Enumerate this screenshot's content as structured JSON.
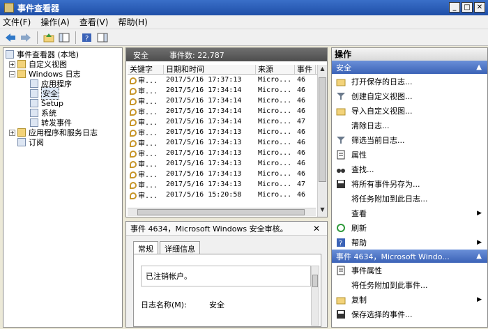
{
  "window": {
    "title": "事件查看器"
  },
  "menu": [
    "文件(F)",
    "操作(A)",
    "查看(V)",
    "帮助(H)"
  ],
  "tree": {
    "root": "事件查看器 (本地)",
    "custom_views": "自定义视图",
    "windows_logs": "Windows 日志",
    "logs": [
      "应用程序",
      "安全",
      "Setup",
      "系统",
      "转发事件"
    ],
    "apps_services": "应用程序和服务日志",
    "subscriptions": "订阅"
  },
  "log_header": {
    "name": "安全",
    "count_label": "事件数: 22,787"
  },
  "grid": {
    "columns": [
      "关键字",
      "日期和时间",
      "来源",
      "事件"
    ],
    "rows": [
      {
        "kw": "审...",
        "dt": "2017/5/16 17:37:13",
        "src": "Micro...",
        "id": "46"
      },
      {
        "kw": "审...",
        "dt": "2017/5/16 17:34:14",
        "src": "Micro...",
        "id": "46"
      },
      {
        "kw": "审...",
        "dt": "2017/5/16 17:34:14",
        "src": "Micro...",
        "id": "46"
      },
      {
        "kw": "审...",
        "dt": "2017/5/16 17:34:14",
        "src": "Micro...",
        "id": "46"
      },
      {
        "kw": "审...",
        "dt": "2017/5/16 17:34:14",
        "src": "Micro...",
        "id": "47"
      },
      {
        "kw": "审...",
        "dt": "2017/5/16 17:34:13",
        "src": "Micro...",
        "id": "46"
      },
      {
        "kw": "审...",
        "dt": "2017/5/16 17:34:13",
        "src": "Micro...",
        "id": "46"
      },
      {
        "kw": "审...",
        "dt": "2017/5/16 17:34:13",
        "src": "Micro...",
        "id": "46"
      },
      {
        "kw": "审...",
        "dt": "2017/5/16 17:34:13",
        "src": "Micro...",
        "id": "46"
      },
      {
        "kw": "审...",
        "dt": "2017/5/16 17:34:13",
        "src": "Micro...",
        "id": "46"
      },
      {
        "kw": "审...",
        "dt": "2017/5/16 17:34:13",
        "src": "Micro...",
        "id": "47"
      },
      {
        "kw": "审...",
        "dt": "2017/5/16 15:20:58",
        "src": "Micro...",
        "id": "46"
      }
    ]
  },
  "detail": {
    "title": "事件 4634，Microsoft Windows 安全审核。",
    "tabs": [
      "常规",
      "详细信息"
    ],
    "message": "已注销帐户。",
    "log_name_label": "日志名称(M):",
    "log_name_value": "安全"
  },
  "actions": {
    "title": "操作",
    "section1": "安全",
    "items1": [
      "打开保存的日志...",
      "创建自定义视图...",
      "导入自定义视图...",
      "清除日志...",
      "筛选当前日志...",
      "属性",
      "查找...",
      "将所有事件另存为...",
      "将任务附加到此日志...",
      "查看",
      "刷新",
      "帮助"
    ],
    "section2": "事件 4634，Microsoft Windo...",
    "items2": [
      "事件属性",
      "将任务附加到此事件...",
      "复制",
      "保存选择的事件..."
    ]
  }
}
